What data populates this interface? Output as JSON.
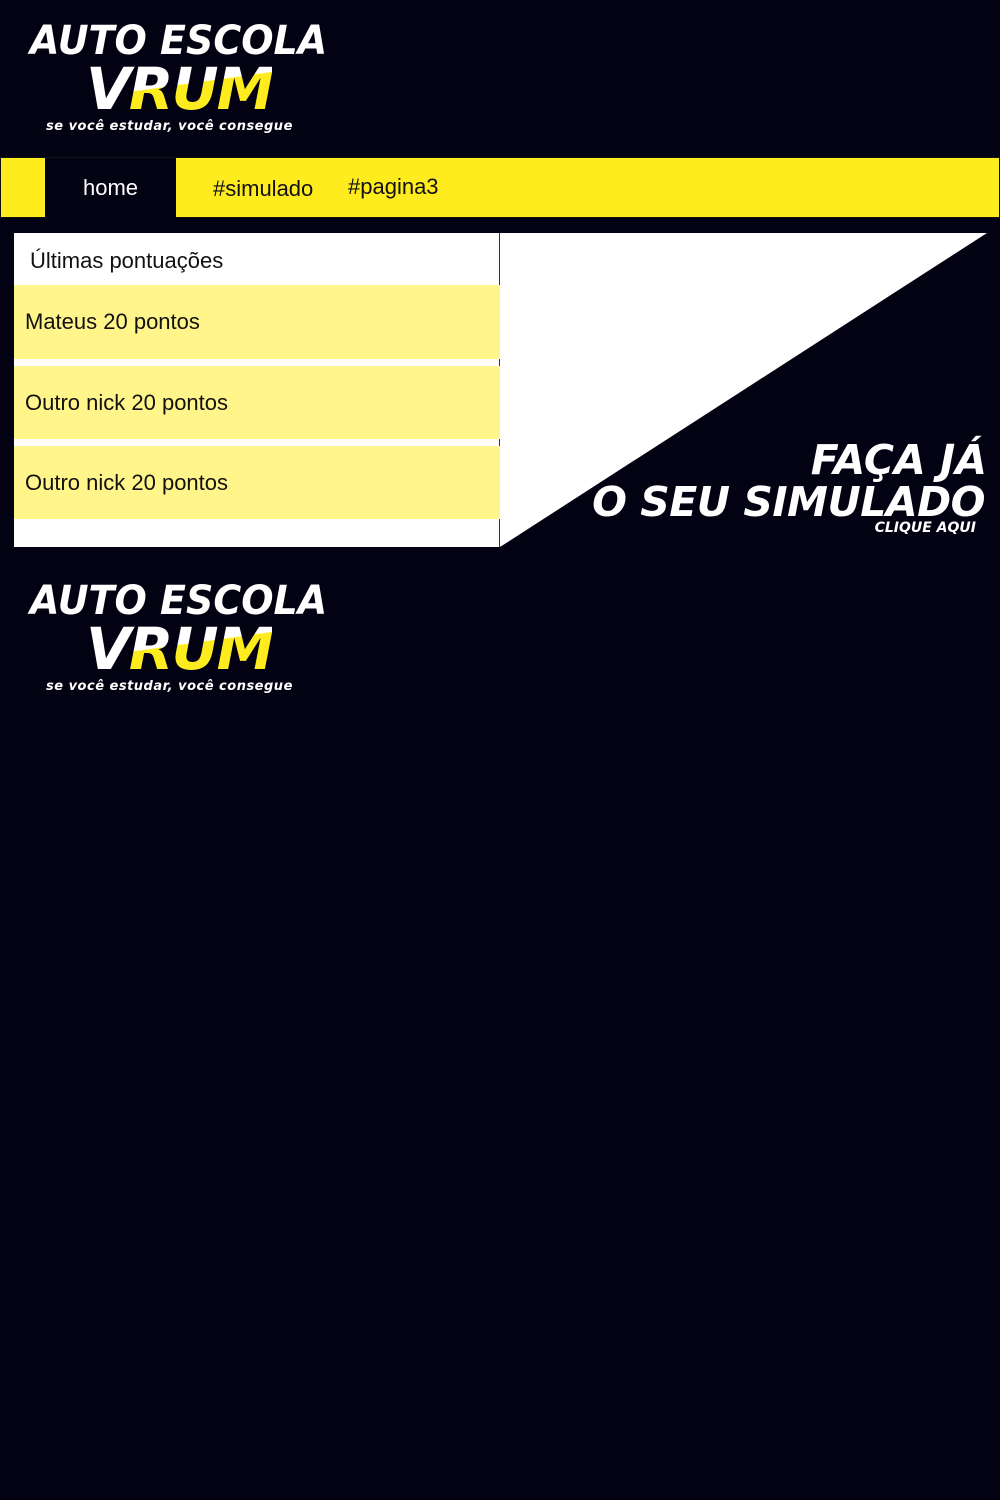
{
  "brand": {
    "title_line1": "AUTO ESCOLA",
    "title_v": "V",
    "title_rum": "RUM",
    "tagline": "se você estudar, você consegue"
  },
  "nav": {
    "tabs": [
      {
        "label": "home",
        "active": true
      },
      {
        "label": "#simulado",
        "active": false
      },
      {
        "label": "#pagina3",
        "active": false
      }
    ]
  },
  "scores": {
    "heading": "Últimas pontuações",
    "items": [
      {
        "text": "Mateus 20 pontos"
      },
      {
        "text": "Outro nick 20 pontos"
      },
      {
        "text": "Outro nick 20 pontos"
      }
    ]
  },
  "cta": {
    "line1": "FAÇA JÁ",
    "line2": "O SEU SIMULADO",
    "sub": "CLIQUE AQUI"
  },
  "colors": {
    "background": "#020212",
    "accent": "#ffec1f",
    "row_highlight": "#fff58a",
    "panel": "#ffffff"
  }
}
